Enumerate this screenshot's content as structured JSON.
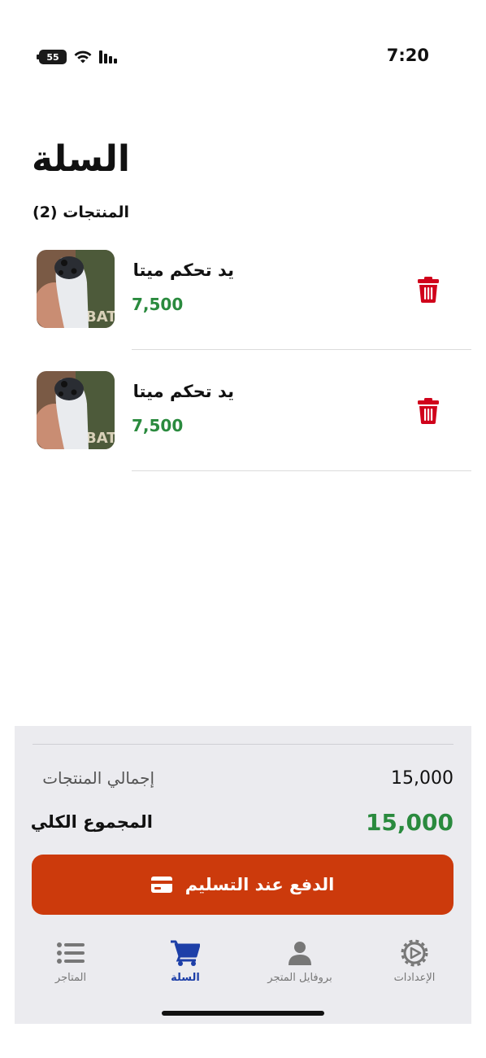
{
  "status_bar": {
    "time": "7:20",
    "battery": "55"
  },
  "header": {
    "title": "السلة",
    "products_count": "المنتجات (2)"
  },
  "cart": {
    "items": [
      {
        "name": "يد تحكم ميتا",
        "price": "7,500",
        "image_icon": "product-photo"
      },
      {
        "name": "يد تحكم ميتا",
        "price": "7,500",
        "image_icon": "product-photo"
      }
    ]
  },
  "summary": {
    "subtotal_label": "إجمالي المنتجات",
    "subtotal_value": "15,000",
    "total_label": "المجموع الكلي",
    "total_value": "15,000",
    "checkout_label": "الدفع عند التسليم"
  },
  "tabs": [
    {
      "label": "المتاجر",
      "icon": "list-icon",
      "active": false
    },
    {
      "label": "السلة",
      "icon": "cart-icon",
      "active": true
    },
    {
      "label": "بروفايل المتجر",
      "icon": "person-icon",
      "active": false
    },
    {
      "label": "الإعدادات",
      "icon": "gear-icon",
      "active": false
    }
  ],
  "colors": {
    "price_green": "#2a8a3e",
    "delete_red": "#d0021b",
    "checkout_orange": "#cc3a0c",
    "active_tab_blue": "#1d3fa8"
  }
}
